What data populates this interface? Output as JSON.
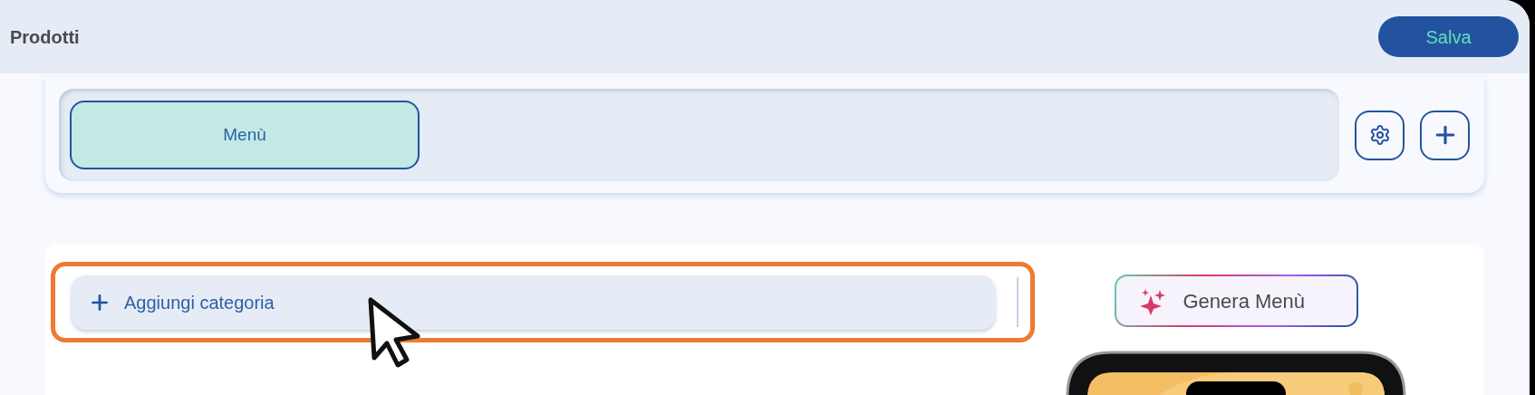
{
  "header": {
    "title": "Prodotti",
    "save_button": "Salva"
  },
  "menu_tabs": [
    {
      "label": "Menù",
      "selected": true
    }
  ],
  "categories": {
    "add_button": "Aggiungi categoria"
  },
  "generate_button": "Genera Menù"
}
